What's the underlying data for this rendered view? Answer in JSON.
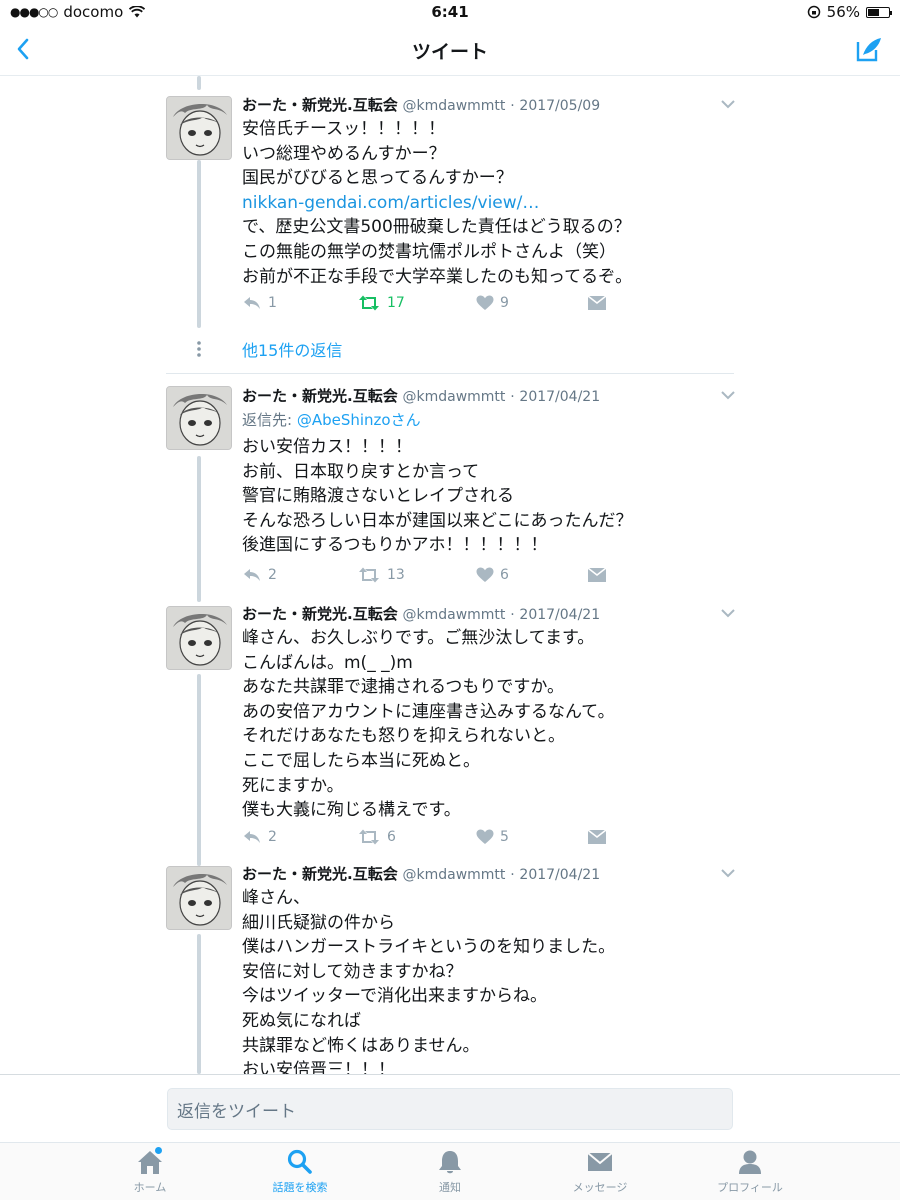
{
  "status_bar": {
    "carrier": "docomo",
    "time": "6:41",
    "battery_percent": "56%",
    "battery_level": 0.56
  },
  "nav": {
    "title": "ツイート",
    "back_icon": "chevron-left-icon",
    "compose_icon": "compose-icon"
  },
  "tweets": [
    {
      "name": "おーた・新党光.互転会",
      "handle": "@kmdawmmtt",
      "date": "2017/05/09",
      "lines": [
        "安倍氏チースッ！！！！！",
        "いつ総理やめるんすかー？",
        "国民がびびると思ってるんすかー？"
      ],
      "link": "nikkan-gendai.com/articles/view/…",
      "lines_after": [
        "で、歴史公文書500冊破棄した責任はどう取るの？",
        "この無能の無学の焚書坑儒ポルポトさんよ（笑）",
        "お前が不正な手段で大学卒業したのも知ってるぞ。"
      ],
      "replies": "1",
      "retweets": "17",
      "likes": "9",
      "retweeted": true
    },
    {
      "name": "おーた・新党光.互転会",
      "handle": "@kmdawmmtt",
      "date": "2017/04/21",
      "reply_to_label": "返信先:",
      "reply_to_mention": "@AbeShinzoさん",
      "lines": [
        "おい安倍カス！！！！",
        "お前、日本取り戻すとか言って",
        "警官に賄賂渡さないとレイプされる",
        "そんな恐ろしい日本が建国以来どこにあったんだ？",
        "後進国にするつもりかアホ！！！！！！"
      ],
      "replies": "2",
      "retweets": "13",
      "likes": "6"
    },
    {
      "name": "おーた・新党光.互転会",
      "handle": "@kmdawmmtt",
      "date": "2017/04/21",
      "lines": [
        "峰さん、お久しぶりです。ご無沙汰してます。",
        "こんばんは。m(_ _)m",
        "あなた共謀罪で逮捕されるつもりですか。",
        "あの安倍アカウントに連座書き込みするなんて。",
        "それだけあなたも怒りを抑えられないと。",
        "ここで屈したら本当に死ぬと。",
        "死にますか。",
        "僕も大義に殉じる構えです。"
      ],
      "replies": "2",
      "retweets": "6",
      "likes": "5"
    },
    {
      "name": "おーた・新党光.互転会",
      "handle": "@kmdawmmtt",
      "date": "2017/04/21",
      "lines": [
        "峰さん、",
        "細川氏疑獄の件から",
        "僕はハンガーストライキというのを知りました。",
        "安倍に対して効きますかね？",
        "今はツイッターで消化出来ますからね。",
        "死ぬ気になれば",
        "共謀罪など怖くはありません。",
        "おい安倍晋三！！！"
      ]
    }
  ],
  "more_replies": "他15件の返信",
  "reply_placeholder": "返信をツイート",
  "tabs": [
    {
      "label": "ホーム",
      "icon": "home-icon",
      "active": false
    },
    {
      "label": "話題を検索",
      "icon": "search-icon",
      "active": true
    },
    {
      "label": "通知",
      "icon": "bell-icon",
      "active": false
    },
    {
      "label": "メッセージ",
      "icon": "envelope-icon",
      "active": false
    },
    {
      "label": "プロフィール",
      "icon": "person-icon",
      "active": false
    }
  ],
  "colors": {
    "accent": "#1da1f2",
    "retweet_active": "#17bf63",
    "muted": "#8899a6"
  }
}
